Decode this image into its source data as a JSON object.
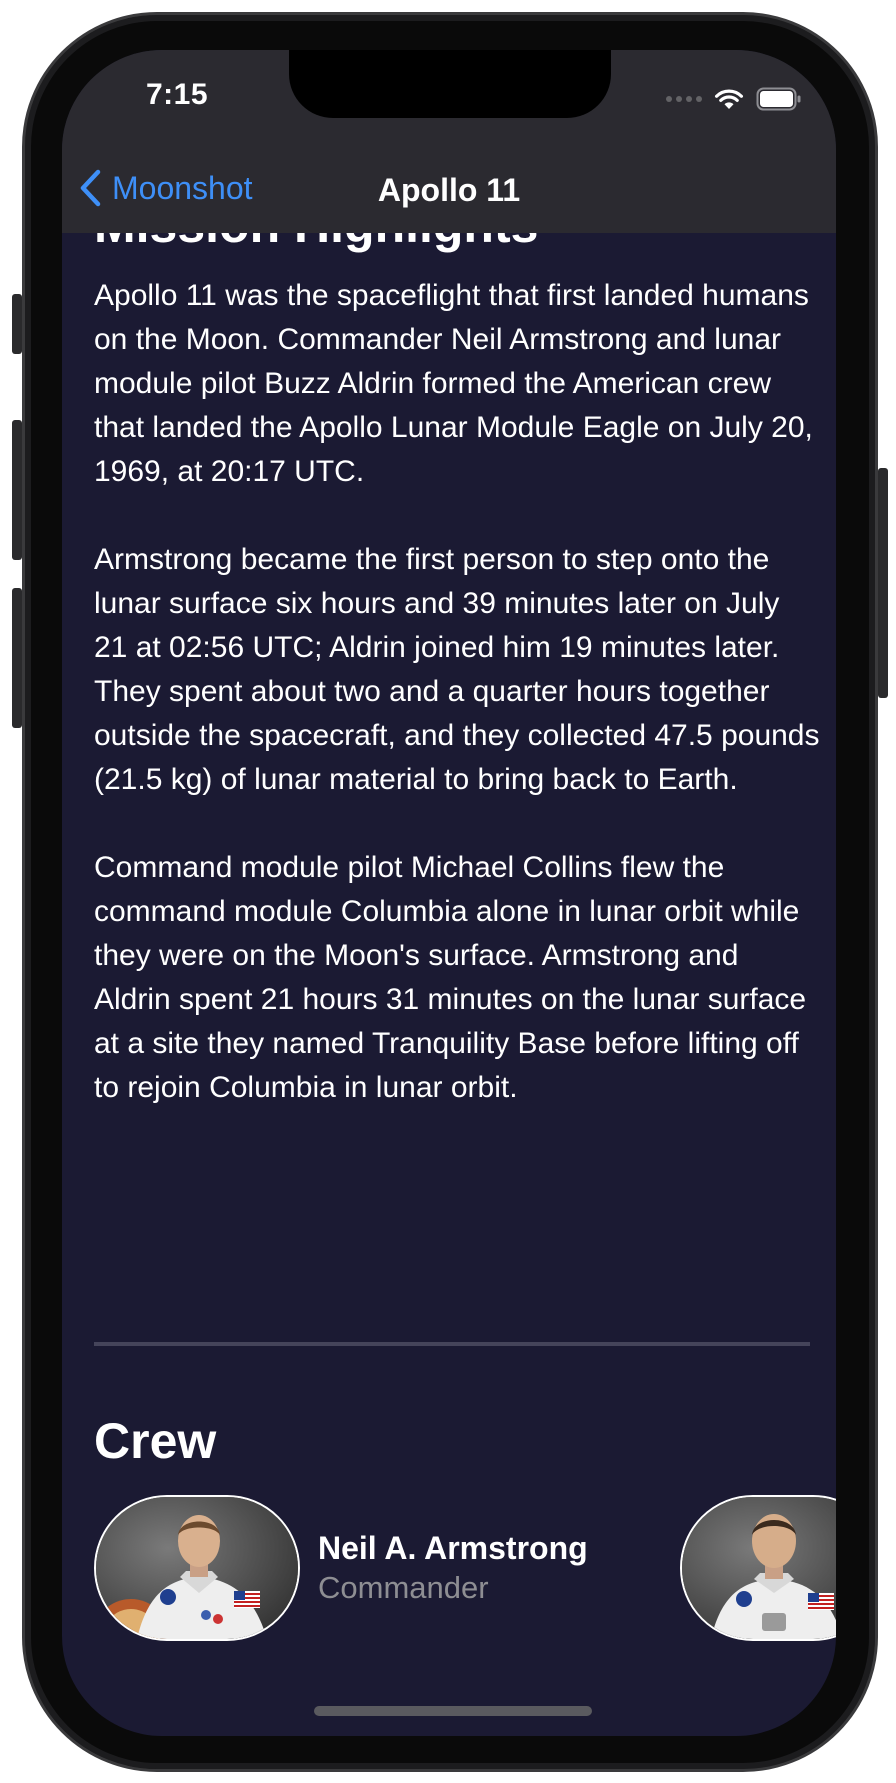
{
  "status_bar": {
    "time": "7:15",
    "icons": [
      "signal-dots-icon",
      "wifi-icon",
      "battery-icon"
    ]
  },
  "nav": {
    "back_label": "Moonshot",
    "title": "Apollo 11"
  },
  "section_heading": "Mission Highlights",
  "description": {
    "paragraphs": [
      "Apollo 11 was the spaceflight that first landed humans on the Moon. Commander Neil Armstrong and lunar module pilot Buzz Aldrin formed the American crew that landed the Apollo Lunar Module Eagle on July 20, 1969, at 20:17 UTC.",
      "Armstrong became the first person to step onto the lunar surface six hours and 39 minutes later on July 21 at 02:56 UTC; Aldrin joined him 19 minutes later. They spent about two and a quarter hours together outside the spacecraft, and they collected 47.5 pounds (21.5 kg) of lunar material to bring back to Earth.",
      "Command module pilot Michael Collins flew the command module Columbia alone in lunar orbit while they were on the Moon's surface. Armstrong and Aldrin spent 21 hours 31 minutes on the lunar surface at a site they named Tranquility Base before lifting off to rejoin Columbia in lunar orbit."
    ]
  },
  "crew": {
    "title": "Crew",
    "members": [
      {
        "name": "Neil A. Armstrong",
        "role": "Commander"
      }
    ]
  },
  "colors": {
    "background": "#1b1a33",
    "nav_bar": "#2b2a30",
    "accent": "#3e8ff7",
    "secondary_text": "#8e8e93",
    "divider": "#45445a"
  }
}
